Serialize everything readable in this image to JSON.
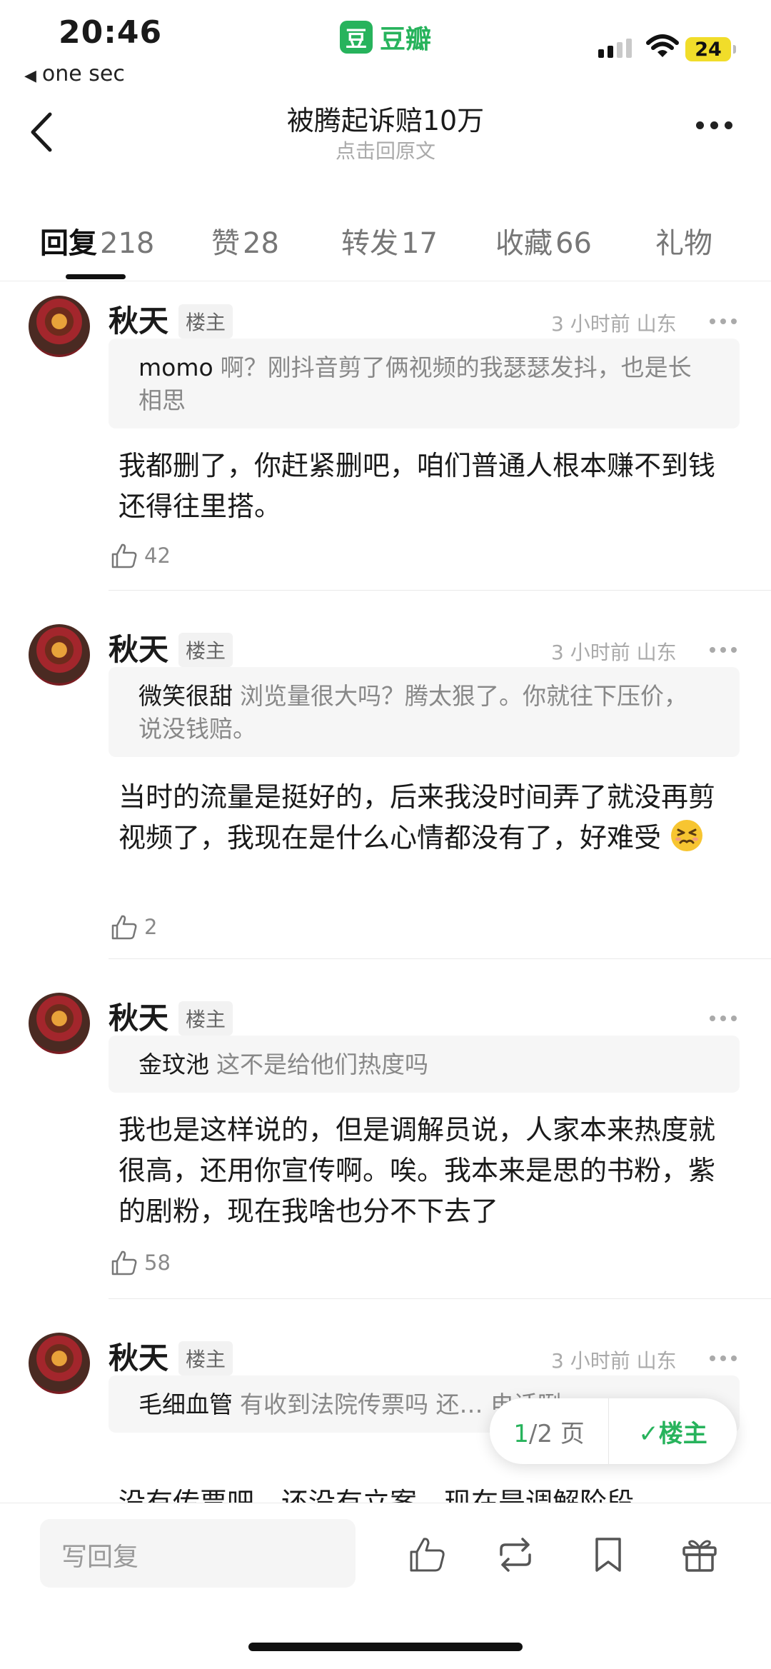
{
  "status_bar": {
    "time": "20:46",
    "back_app": "one sec",
    "app_logo_char": "豆",
    "app_name": "豆瓣",
    "battery": "24"
  },
  "header": {
    "title": "被腾起诉赔10万",
    "subtitle": "点击回原文"
  },
  "tabs": [
    {
      "label": "回复",
      "count": "218"
    },
    {
      "label": "赞",
      "count": "28"
    },
    {
      "label": "转发",
      "count": "17"
    },
    {
      "label": "收藏",
      "count": "66"
    },
    {
      "label": "礼物",
      "count": ""
    }
  ],
  "comments": [
    {
      "author": "秋天",
      "badge": "楼主",
      "meta": "3 小时前  山东",
      "quote_name": "momo",
      "quote_text": "啊？刚抖音剪了俩视频的我瑟瑟发抖，也是长相思",
      "reply": "我都删了，你赶紧删吧，咱们普通人根本赚不到钱还得往里搭。",
      "likes": "42"
    },
    {
      "author": "秋天",
      "badge": "楼主",
      "meta": "3 小时前  山东",
      "quote_name": "微笑很甜",
      "quote_text": "浏览量很大吗？腾太狠了。你就往下压价，说没钱赔。",
      "reply": "当时的流量是挺好的，后来我没时间弄了就没再剪视频了，我现在是什么心情都没有了，好难受",
      "likes": "2"
    },
    {
      "author": "秋天",
      "badge": "楼主",
      "meta": "",
      "quote_name": "金玟池",
      "quote_text": "这不是给他们热度吗",
      "reply": "我也是这样说的，但是调解员说，人家本来热度就很高，还用你宣传啊。唉。我本来是思的书粉，紫的剧粉，现在我啥也分不下去了",
      "likes": "58"
    },
    {
      "author": "秋天",
      "badge": "楼主",
      "meta": "3 小时前  山东",
      "quote_name": "毛细血管",
      "quote_text": "有收到法院传票吗 还… 电话咧",
      "reply": "没有传票吧，还没有立案，现在是调解阶段",
      "likes": ""
    }
  ],
  "pager": {
    "current": "1",
    "total": "/2 页",
    "op_label": "楼主"
  },
  "bottom_bar": {
    "reply_placeholder": "写回复"
  }
}
